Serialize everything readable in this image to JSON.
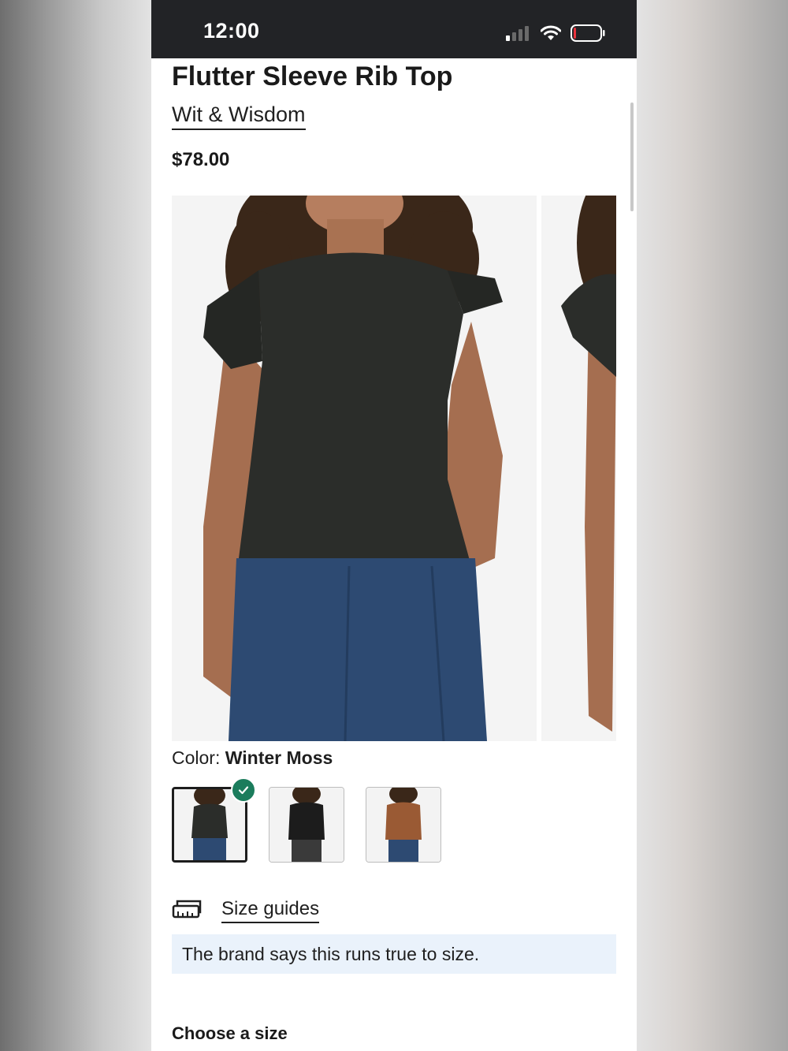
{
  "status_bar": {
    "time": "12:00"
  },
  "product": {
    "title": "Flutter Sleeve Rib Top",
    "brand": "Wit & Wisdom",
    "price": "$78.00"
  },
  "color": {
    "label": "Color:",
    "selected_value": "Winter Moss",
    "swatches": [
      {
        "name": "Winter Moss",
        "selected": true,
        "color": "#2b2d2a"
      },
      {
        "name": "Black",
        "selected": false,
        "color": "#1c1c1c"
      },
      {
        "name": "Brown",
        "selected": false,
        "color": "#9a5a34"
      }
    ]
  },
  "size_guides": {
    "label": "Size guides",
    "icon": "ruler-icon"
  },
  "fit_note": "The brand says this runs true to size.",
  "size_section": {
    "heading": "Choose a size"
  },
  "colors": {
    "accent_check": "#1b7c5c",
    "fit_note_bg": "#eaf2fb",
    "status_bar_bg": "#222326"
  }
}
